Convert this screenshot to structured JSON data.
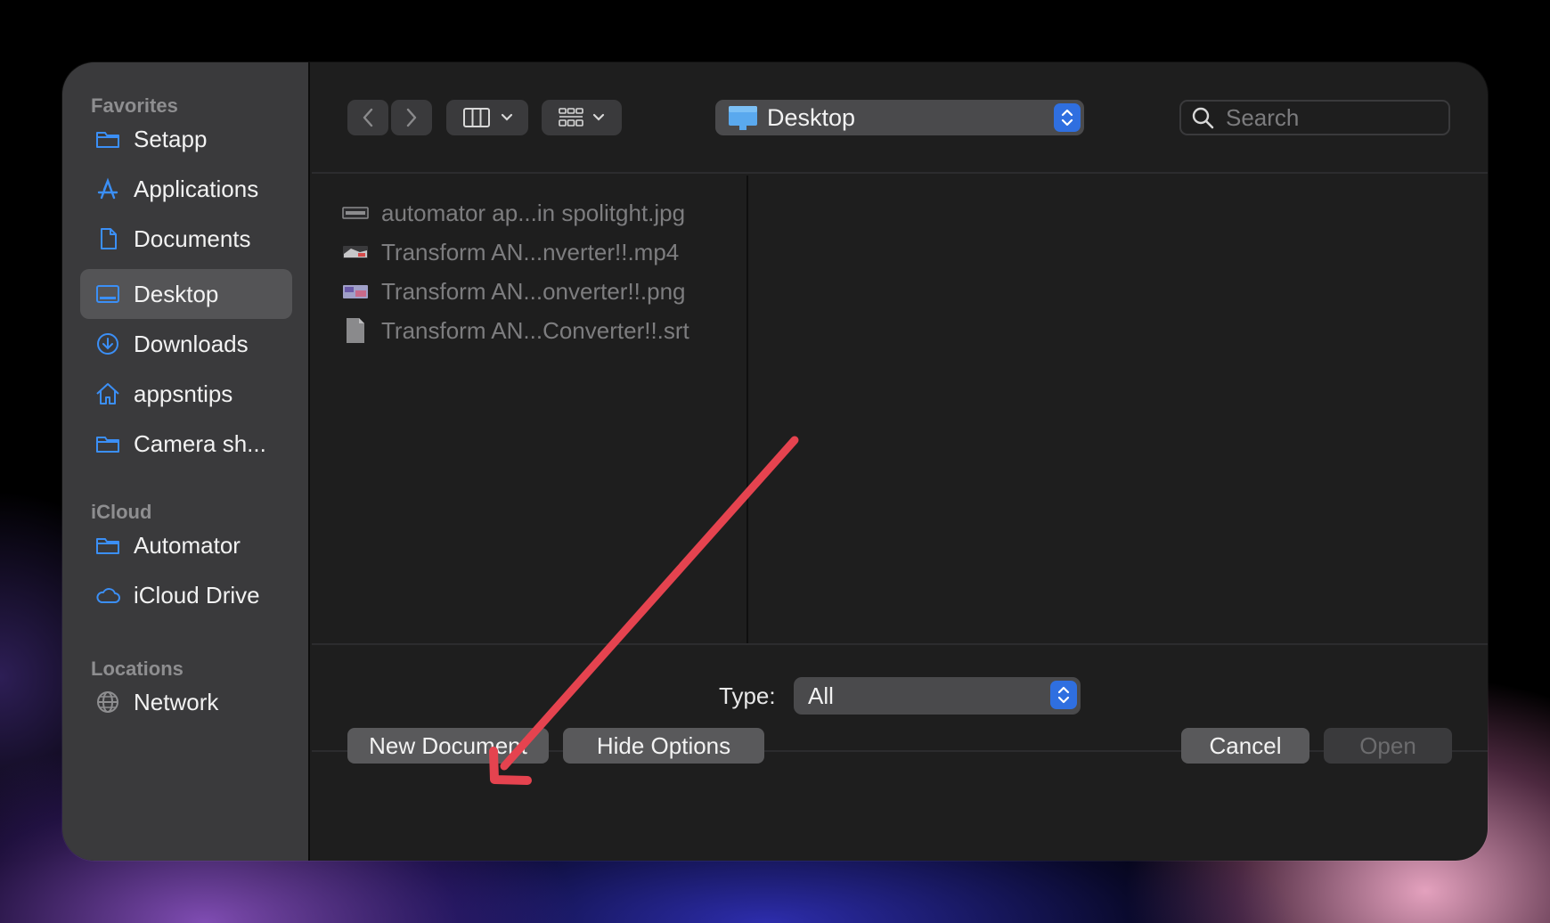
{
  "sidebar": {
    "sections": [
      {
        "title": "Favorites"
      },
      {
        "title": "iCloud"
      },
      {
        "title": "Locations"
      }
    ],
    "items": [
      {
        "label": "Setapp",
        "icon": "folder-icon"
      },
      {
        "label": "Applications",
        "icon": "applications-icon"
      },
      {
        "label": "Documents",
        "icon": "document-icon"
      },
      {
        "label": "Desktop",
        "icon": "desktop-icon",
        "selected": true
      },
      {
        "label": "Downloads",
        "icon": "download-icon"
      },
      {
        "label": "appsntips",
        "icon": "home-icon"
      },
      {
        "label": "Camera sh...",
        "icon": "folder-icon"
      },
      {
        "label": "Automator",
        "icon": "folder-icon"
      },
      {
        "label": "iCloud Drive",
        "icon": "cloud-icon"
      },
      {
        "label": "Network",
        "icon": "globe-icon"
      }
    ]
  },
  "toolbar": {
    "location": "Desktop",
    "search_placeholder": "Search"
  },
  "files": [
    {
      "name": "automator ap...in spolitght.jpg",
      "icon": "image-file-icon"
    },
    {
      "name": "Transform AN...nverter!!.mp4",
      "icon": "video-file-icon"
    },
    {
      "name": "Transform AN...onverter!!.png",
      "icon": "image-file-icon"
    },
    {
      "name": "Transform AN...Converter!!.srt",
      "icon": "text-file-icon"
    }
  ],
  "options": {
    "type_label": "Type:",
    "type_value": "All"
  },
  "buttons": {
    "new_document": "New Document",
    "hide_options": "Hide Options",
    "cancel": "Cancel",
    "open": "Open"
  },
  "colors": {
    "accent": "#2f6fe0",
    "sidebar_icon": "#3b8ff6",
    "annotation_arrow": "#e5434f"
  }
}
